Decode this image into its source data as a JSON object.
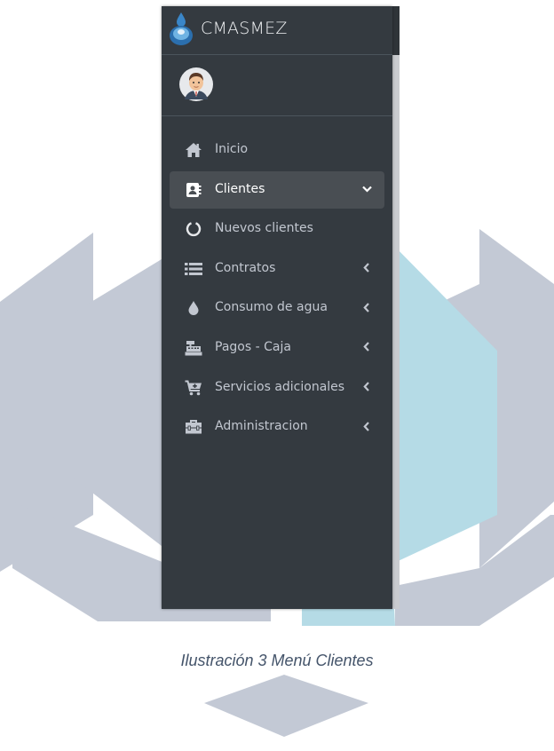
{
  "brand": {
    "name": "CMASMEZ",
    "icon": "water-drop-logo-icon"
  },
  "user": {
    "avatar_icon": "user-avatar-icon"
  },
  "nav": {
    "items": [
      {
        "label": "Inicio",
        "icon": "home-icon",
        "arrow": ""
      },
      {
        "label": "Clientes",
        "icon": "address-book-icon",
        "arrow": "chevron-down-icon",
        "active": true
      },
      {
        "label": "Nuevos clientes",
        "icon": "circle-notch-icon",
        "arrow": ""
      },
      {
        "label": "Contratos",
        "icon": "list-icon",
        "arrow": "chevron-left-icon"
      },
      {
        "label": "Consumo de agua",
        "icon": "tint-icon",
        "arrow": "chevron-left-icon"
      },
      {
        "label": "Pagos - Caja",
        "icon": "cash-register-icon",
        "arrow": "chevron-left-icon"
      },
      {
        "label": "Servicios adicionales",
        "icon": "cart-plus-icon",
        "arrow": "chevron-left-icon"
      },
      {
        "label": "Administracion",
        "icon": "toolbox-icon",
        "arrow": "chevron-left-icon"
      }
    ]
  },
  "caption": "Ilustración 3 Menú Clientes",
  "colors": {
    "sidebar_bg": "#343a40",
    "active_item_bg": "#494e53",
    "watermark_gray": "#bfc5d2",
    "watermark_blue": "#b3d9e4",
    "caption": "#44546a"
  }
}
